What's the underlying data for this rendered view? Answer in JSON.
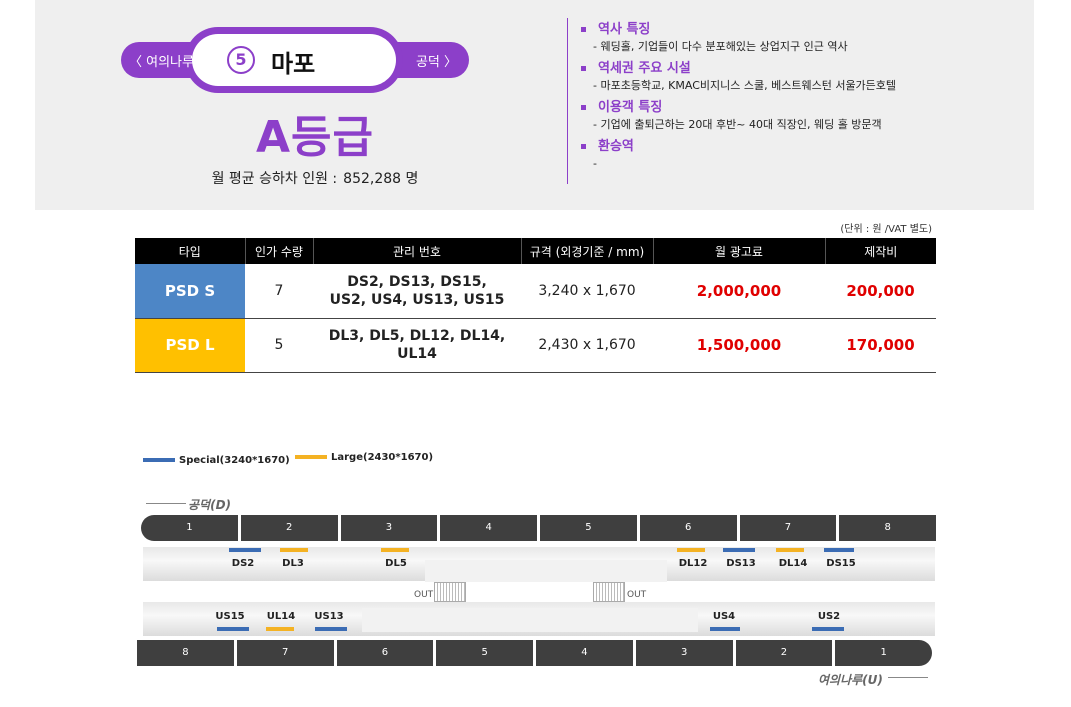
{
  "station": {
    "prev": "〈 여의나루",
    "next": "공덕 〉",
    "number": "5",
    "name": "마포",
    "grade": "A등급",
    "passengers_label": "월 평균 승하차 인원 :",
    "passengers_value": "852,288 명"
  },
  "features": [
    {
      "title": "역사 특징",
      "desc": "-  웨딩홀, 기업들이 다수 분포해있는 상업지구 인근 역사"
    },
    {
      "title": "역세권 주요 시설",
      "desc": "-  마포초등학교, KMAC비지니스 스쿨, 베스트웨스턴 서울가든호텔"
    },
    {
      "title": "이용객 특징",
      "desc": "-  기업에 출퇴근하는 20대 후반~ 40대 직장인, 웨딩 홀 방문객"
    },
    {
      "title": "환승역",
      "desc": "-"
    }
  ],
  "table": {
    "unit_note": "(단위 : 원 /VAT 별도)",
    "headers": [
      "타입",
      "인가 수량",
      "관리 번호",
      "규격 (외경기준 / mm)",
      "월 광고료",
      "제작비"
    ],
    "rows": [
      {
        "type": "PSD S",
        "qty": "7",
        "ids_1": "DS2, DS13, DS15,",
        "ids_2": "US2, US4, US13, US15",
        "size": "3,240 x 1,670",
        "fee": "2,000,000",
        "cost": "200,000"
      },
      {
        "type": "PSD L",
        "qty": "5",
        "ids_1": "DL3, DL5, DL12, DL14,",
        "ids_2": "UL14",
        "size": "2,430 x 1,670",
        "fee": "1,500,000",
        "cost": "170,000"
      }
    ]
  },
  "map": {
    "legend_special": "Special(3240*1670)",
    "legend_large": "Large(2430*1670)",
    "dir_top": "공덕(D)",
    "dir_bottom": "여의나루(U)",
    "out_label": "OUT",
    "top_cars": [
      "1",
      "2",
      "3",
      "4",
      "5",
      "6",
      "7",
      "8"
    ],
    "bottom_cars": [
      "8",
      "7",
      "6",
      "5",
      "4",
      "3",
      "2",
      "1"
    ],
    "down_markers": [
      "DS2",
      "DL3",
      "DL5",
      "DL12",
      "DS13",
      "DL14",
      "DS15"
    ],
    "up_markers": [
      "US15",
      "UL14",
      "US13",
      "US4",
      "US2"
    ]
  },
  "colors": {
    "accent": "#8c3fc9",
    "special": "#3b6cb4",
    "large": "#f4b223",
    "price": "#e00000"
  }
}
